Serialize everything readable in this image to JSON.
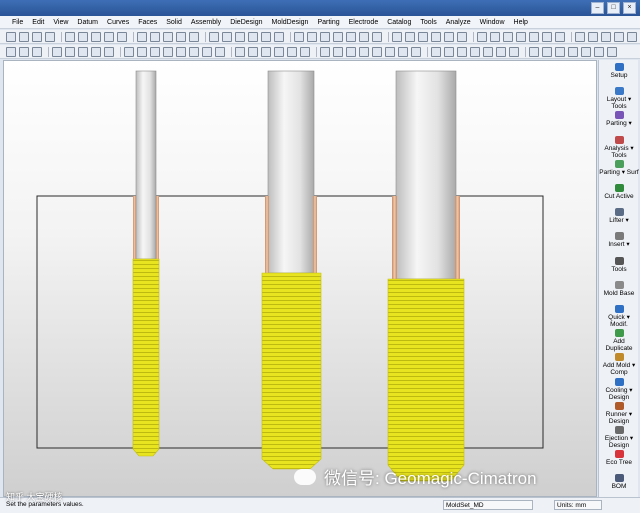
{
  "menu": {
    "items": [
      "File",
      "Edit",
      "View",
      "Datum",
      "Curves",
      "Faces",
      "Solid",
      "Assembly",
      "DieDesign",
      "MoldDesign",
      "Parting",
      "Electrode",
      "Catalog",
      "Tools",
      "Analyze",
      "Window",
      "Help"
    ]
  },
  "window_controls": [
    "minimize",
    "restore",
    "close"
  ],
  "side_panel": {
    "items": [
      {
        "label": "Setup",
        "icon": "setup-icon",
        "color": "#2f6fc4"
      },
      {
        "label": "Layout ▾ Tools",
        "icon": "layout-tools-icon",
        "color": "#3a78c8"
      },
      {
        "label": "Parting ▾",
        "icon": "parting-icon",
        "color": "#7a55b8"
      },
      {
        "label": "Analysis ▾ Tools",
        "icon": "analysis-tools-icon",
        "color": "#c04a4a"
      },
      {
        "label": "Parting ▾ Surf",
        "icon": "parting-surf-icon",
        "color": "#4aa05a"
      },
      {
        "label": "Cut Active",
        "icon": "cut-active-icon",
        "color": "#2f8a3c"
      },
      {
        "label": "Lifter ▾",
        "icon": "lifter-icon",
        "color": "#5b6d86"
      },
      {
        "label": "Insert ▾",
        "icon": "insert-icon",
        "color": "#7a7a7a"
      },
      {
        "label": "Tools",
        "icon": "tools-icon",
        "color": "#555555"
      },
      {
        "label": "Mold Base",
        "icon": "mold-base-icon",
        "color": "#8a8a8a"
      },
      {
        "label": "Quick ▾ Modif.",
        "icon": "quick-modif-icon",
        "color": "#2f6fc4"
      },
      {
        "label": "Add Duplicate",
        "icon": "add-duplicate-icon",
        "color": "#3f9a4a"
      },
      {
        "label": "Add Mold ▾ Comp",
        "icon": "add-mold-comp-icon",
        "color": "#c08a2a"
      },
      {
        "label": "Cooling ▾ Design",
        "icon": "cooling-design-icon",
        "color": "#2f6fc4"
      },
      {
        "label": "Runner ▾ Design",
        "icon": "runner-design-icon",
        "color": "#b05a2a"
      },
      {
        "label": "Ejection ▾ Design",
        "icon": "ejection-design-icon",
        "color": "#6a6a6a"
      },
      {
        "label": "Eco Tree",
        "icon": "eco-tree-icon",
        "color": "#d8323a"
      },
      {
        "label": "BOM",
        "icon": "bom-icon",
        "color": "#4a5a78"
      }
    ]
  },
  "status": {
    "prompt": "Set the parameters values.",
    "set_name": "MoldSet_MD",
    "units": "Units: mm"
  },
  "watermark": {
    "text": "微信号: Geomagic-Cimatron",
    "corner_text": "知乎 大宝硬核"
  },
  "colors": {
    "thread": "#e8e41f",
    "counterbore": "#d9a07a",
    "shaft": "#e4e4e4",
    "block_outline": "#2a2a2a"
  }
}
